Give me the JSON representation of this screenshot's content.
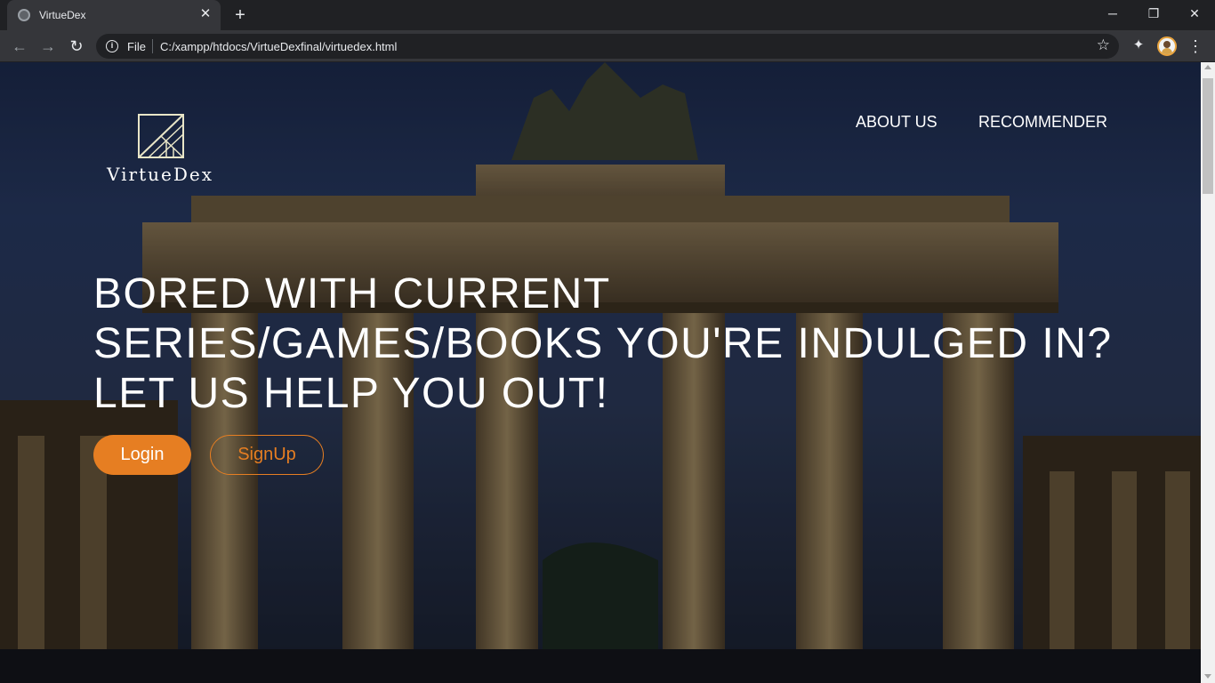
{
  "browser": {
    "tab_title": "VirtueDex",
    "tab_close": "✕",
    "new_tab": "+",
    "window_controls": {
      "minimize": "─",
      "maximize": "❐",
      "close": "✕"
    },
    "nav": {
      "back": "←",
      "forward": "→",
      "reload": "↻"
    },
    "omnibox": {
      "scheme_label": "File",
      "url": "C:/xampp/htdocs/VirtueDexfinal/virtuedex.html"
    },
    "icons": {
      "info": "i",
      "star": "☆",
      "extensions": "✦",
      "menu": "⋮"
    }
  },
  "site": {
    "logo_text": "VirtueDex",
    "nav": {
      "about": "ABOUT US",
      "recommender": "RECOMMENDER"
    },
    "hero": {
      "line1": "BORED WITH CURRENT",
      "line2": "SERIES/GAMES/BOOKS YOU'RE INDULGED IN?",
      "line3": "LET US HELP YOU OUT!"
    },
    "buttons": {
      "login": "Login",
      "signup": "SignUp"
    },
    "colors": {
      "accent": "#e67e22",
      "text": "#ffffff"
    }
  }
}
